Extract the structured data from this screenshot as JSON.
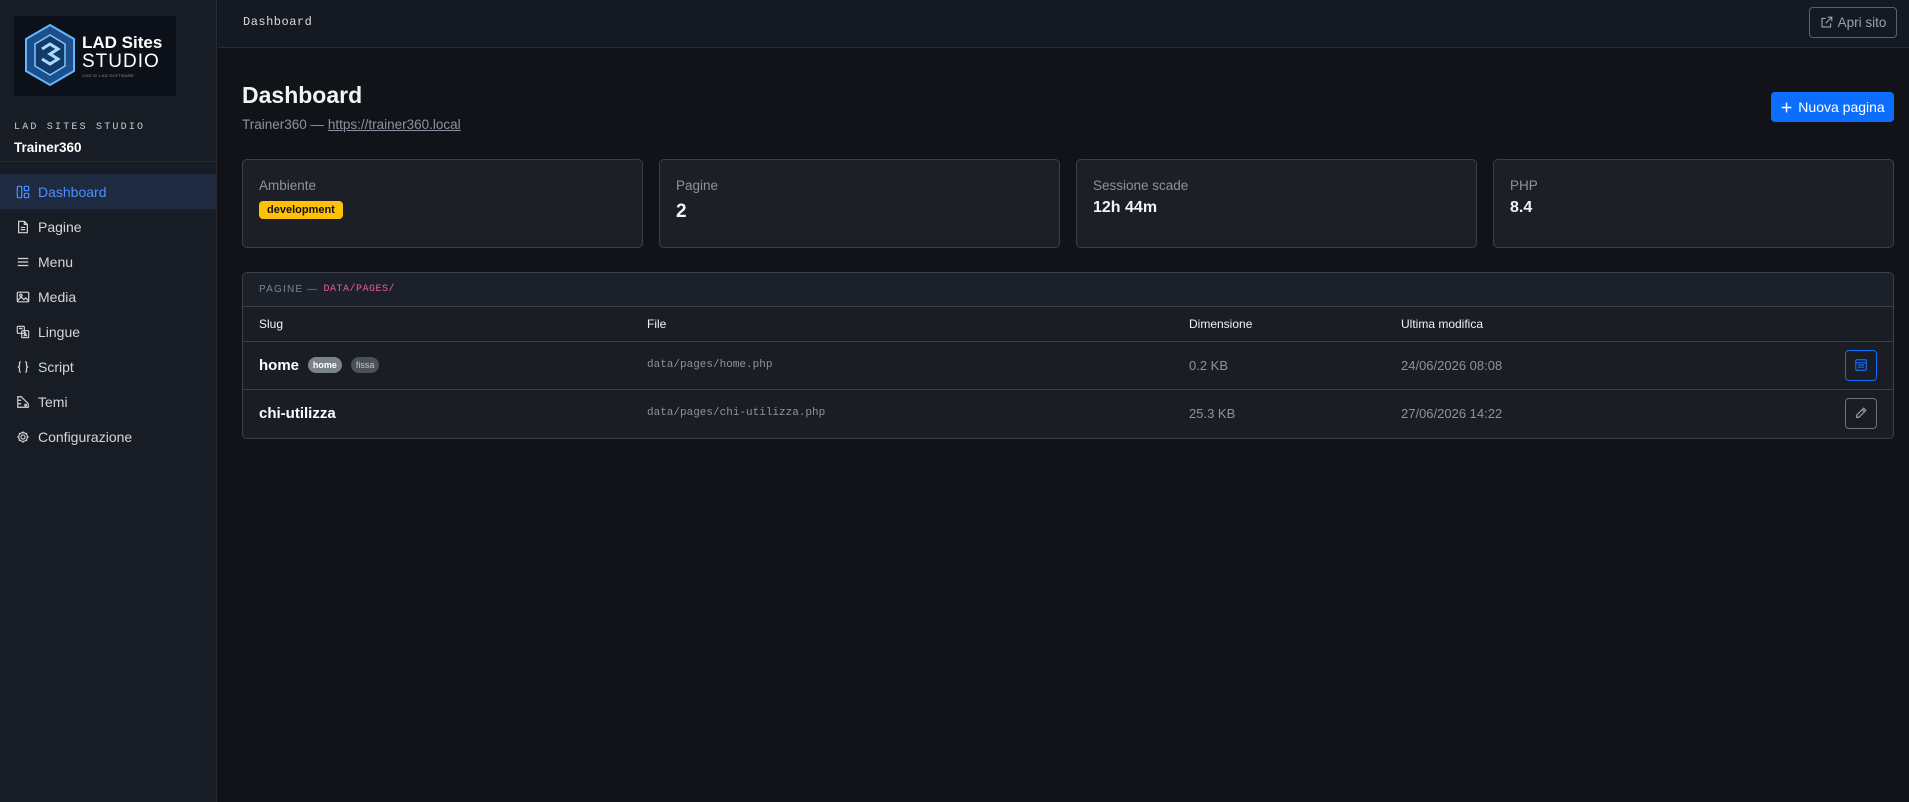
{
  "brand": {
    "logo_line1": "LAD Sites",
    "logo_line2": "STUDIO",
    "logo_line3": "CMS DI LAD SOFTWARE",
    "subtitle": "LAD SITES STUDIO",
    "site_name": "Trainer360"
  },
  "sidebar": {
    "items": [
      {
        "label": "Dashboard",
        "icon": "dashboard-icon",
        "active": true
      },
      {
        "label": "Pagine",
        "icon": "file-icon"
      },
      {
        "label": "Menu",
        "icon": "list-icon"
      },
      {
        "label": "Media",
        "icon": "image-icon"
      },
      {
        "label": "Lingue",
        "icon": "translate-icon"
      },
      {
        "label": "Script",
        "icon": "braces-icon"
      },
      {
        "label": "Temi",
        "icon": "palette-icon"
      },
      {
        "label": "Configurazione",
        "icon": "gear-icon"
      }
    ]
  },
  "topbar": {
    "title": "Dashboard",
    "open_site_label": "Apri sito"
  },
  "header": {
    "title": "Dashboard",
    "site": "Trainer360",
    "separator": " — ",
    "url": "https://trainer360.local",
    "new_page_label": "Nuova pagina"
  },
  "cards": [
    {
      "label": "Ambiente",
      "value": "development"
    },
    {
      "label": "Pagine",
      "value": "2"
    },
    {
      "label": "Sessione scade",
      "value": "12h 44m"
    },
    {
      "label": "PHP",
      "value": "8.4"
    }
  ],
  "pages_table": {
    "heading": "PAGINE —",
    "path": "DATA/PAGES/",
    "columns": [
      "Slug",
      "File",
      "Dimensione",
      "Ultima modifica"
    ],
    "rows": [
      {
        "slug": "home",
        "tags": [
          "home",
          "fissa"
        ],
        "file": "data/pages/home.php",
        "size": "0.2 KB",
        "modified": "24/06/2026 08:08",
        "action": "layout-icon"
      },
      {
        "slug": "chi-utilizza",
        "tags": [],
        "file": "data/pages/chi-utilizza.php",
        "size": "25.3 KB",
        "modified": "27/06/2026 14:22",
        "action": "pencil-icon"
      }
    ]
  },
  "colors": {
    "accent": "#0d6efd",
    "warning": "#ffc107",
    "code_pink": "#e85d9b",
    "background": "#111318"
  }
}
